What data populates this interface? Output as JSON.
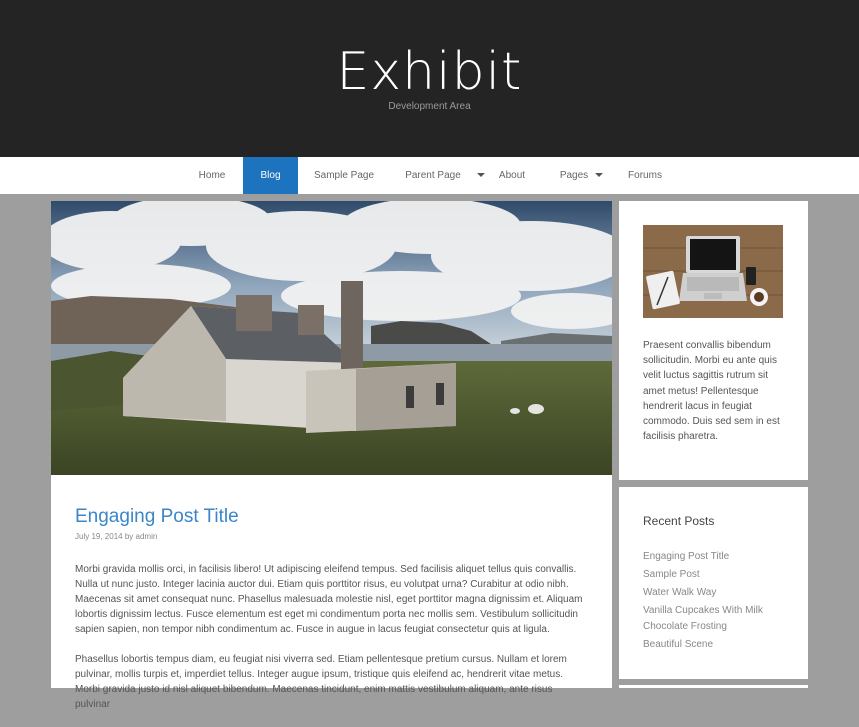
{
  "site": {
    "title": "Exhibit",
    "tagline": "Development Area"
  },
  "nav": {
    "items": [
      {
        "label": "Home"
      },
      {
        "label": "Blog"
      },
      {
        "label": "Sample Page"
      },
      {
        "label": "Parent Page"
      },
      {
        "label": "About"
      },
      {
        "label": "Pages"
      },
      {
        "label": "Forums"
      }
    ],
    "active": "Blog"
  },
  "post": {
    "title": "Engaging Post Title",
    "date": "July 19, 2014",
    "by": "by",
    "author": "admin",
    "paragraphs": [
      "Morbi gravida mollis orci, in facilisis libero! Ut adipiscing eleifend tempus. Sed facilisis aliquet tellus quis convallis. Nulla ut nunc justo. Integer lacinia auctor dui. Etiam quis porttitor risus, eu volutpat urna? Curabitur at odio nibh. Maecenas sit amet consequat nunc. Phasellus malesuada molestie nisl, eget porttitor magna dignissim et. Aliquam lobortis dignissim lectus. Fusce elementum est eget mi condimentum porta nec mollis sem. Vestibulum sollicitudin sapien sapien, non tempor nibh condimentum ac. Fusce in augue in lacus feugiat consectetur quis at ligula.",
      "Phasellus lobortis tempus diam, eu feugiat nisi viverra sed. Etiam pellentesque pretium cursus. Nullam et lorem pulvinar, mollis turpis et, imperdiet tellus. Integer augue ipsum, tristique quis eleifend ac, hendrerit vitae metus. Morbi gravida justo id nisl aliquet bibendum. Maecenas tincidunt, enim mattis vestibulum aliquam, ante risus pulvinar"
    ]
  },
  "sidebar": {
    "text_widget": {
      "text": "Praesent convallis bibendum sollicitudin. Morbi eu ante quis velit luctus sagittis rutrum sit amet metus! Pellentesque hendrerit lacus in feugiat commodo. Duis sed sem in est facilisis pharetra."
    },
    "recent_posts": {
      "title": "Recent Posts",
      "items": [
        "Engaging Post Title",
        "Sample Post",
        "Water Walk Way",
        "Vanilla Cupcakes With Milk Chocolate Frosting",
        "Beautiful Scene"
      ]
    }
  },
  "colors": {
    "accent": "#1e73be",
    "header_bg": "#242424",
    "page_bg": "#9e9e9e",
    "link": "#3a86c8"
  }
}
